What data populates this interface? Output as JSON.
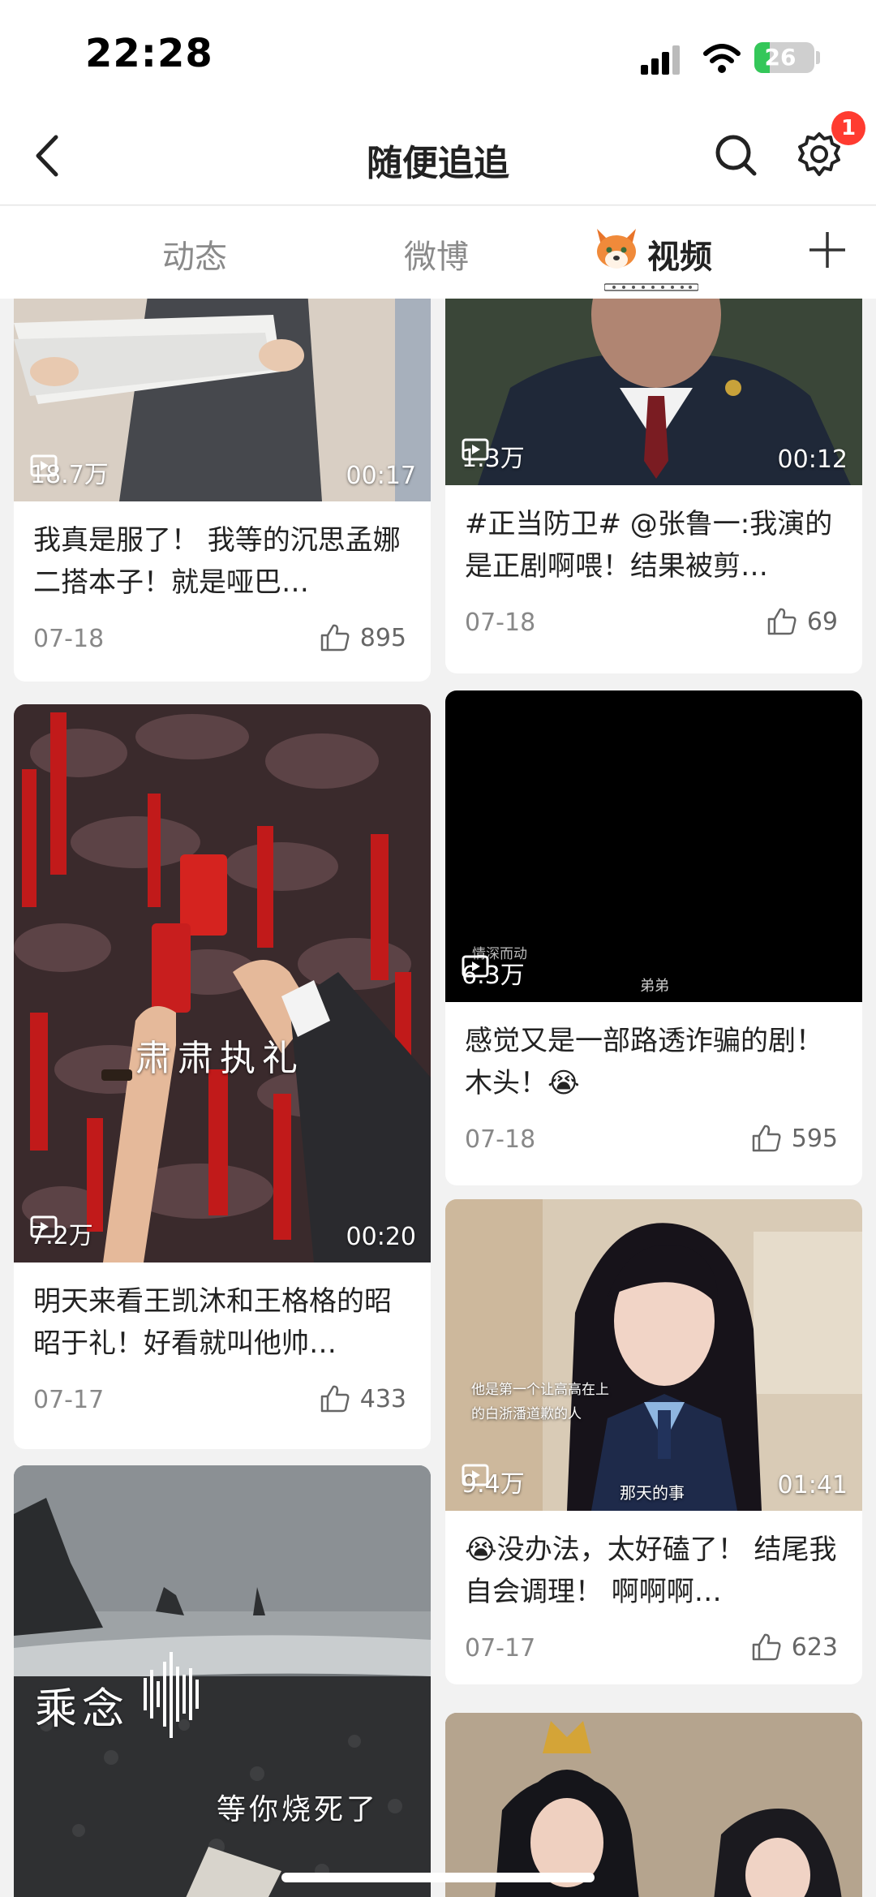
{
  "status_bar": {
    "time": "22:28",
    "battery": "26",
    "battery_level": 0.26
  },
  "nav": {
    "title": "随便追追",
    "badge": "1"
  },
  "tabs": [
    {
      "label": "动态"
    },
    {
      "label": "微博"
    },
    {
      "label": "视频"
    }
  ],
  "cards": [
    {
      "plays": "18.7万",
      "duration": "00:17",
      "title": "我真是服了！ 我等的沉思孟娜二搭本子！就是哑巴…",
      "date": "07-18",
      "likes": "895"
    },
    {
      "plays": "1.3万",
      "duration": "00:12",
      "title": "#正当防卫# @张鲁一:我演的是正剧啊喂！结果被剪…",
      "date": "07-18",
      "likes": "69"
    },
    {
      "plays": "7.2万",
      "duration": "00:20",
      "title": "明天来看王凯沐和王格格的昭昭于礼！好看就叫他帅…",
      "date": "07-17",
      "likes": "433",
      "overlay": "肃肃执礼"
    },
    {
      "plays": "6.3万",
      "duration": "",
      "title": "感觉又是一部路透诈骗的剧！木头！😭",
      "date": "07-18",
      "likes": "595",
      "overlay": "情深而动",
      "overlay2": "弟弟"
    },
    {
      "plays": "9.4万",
      "duration": "01:41",
      "title": "😭没办法，太好磕了！ 结尾我自会调理！ 啊啊啊…",
      "date": "07-17",
      "likes": "623",
      "overlay": "他是第一个让高高在上",
      "overlay2": "的白浙潘道歉的人",
      "overlay3": "那天的事"
    },
    {
      "overlay": "乘念",
      "overlay2": "等你烧死了"
    }
  ]
}
